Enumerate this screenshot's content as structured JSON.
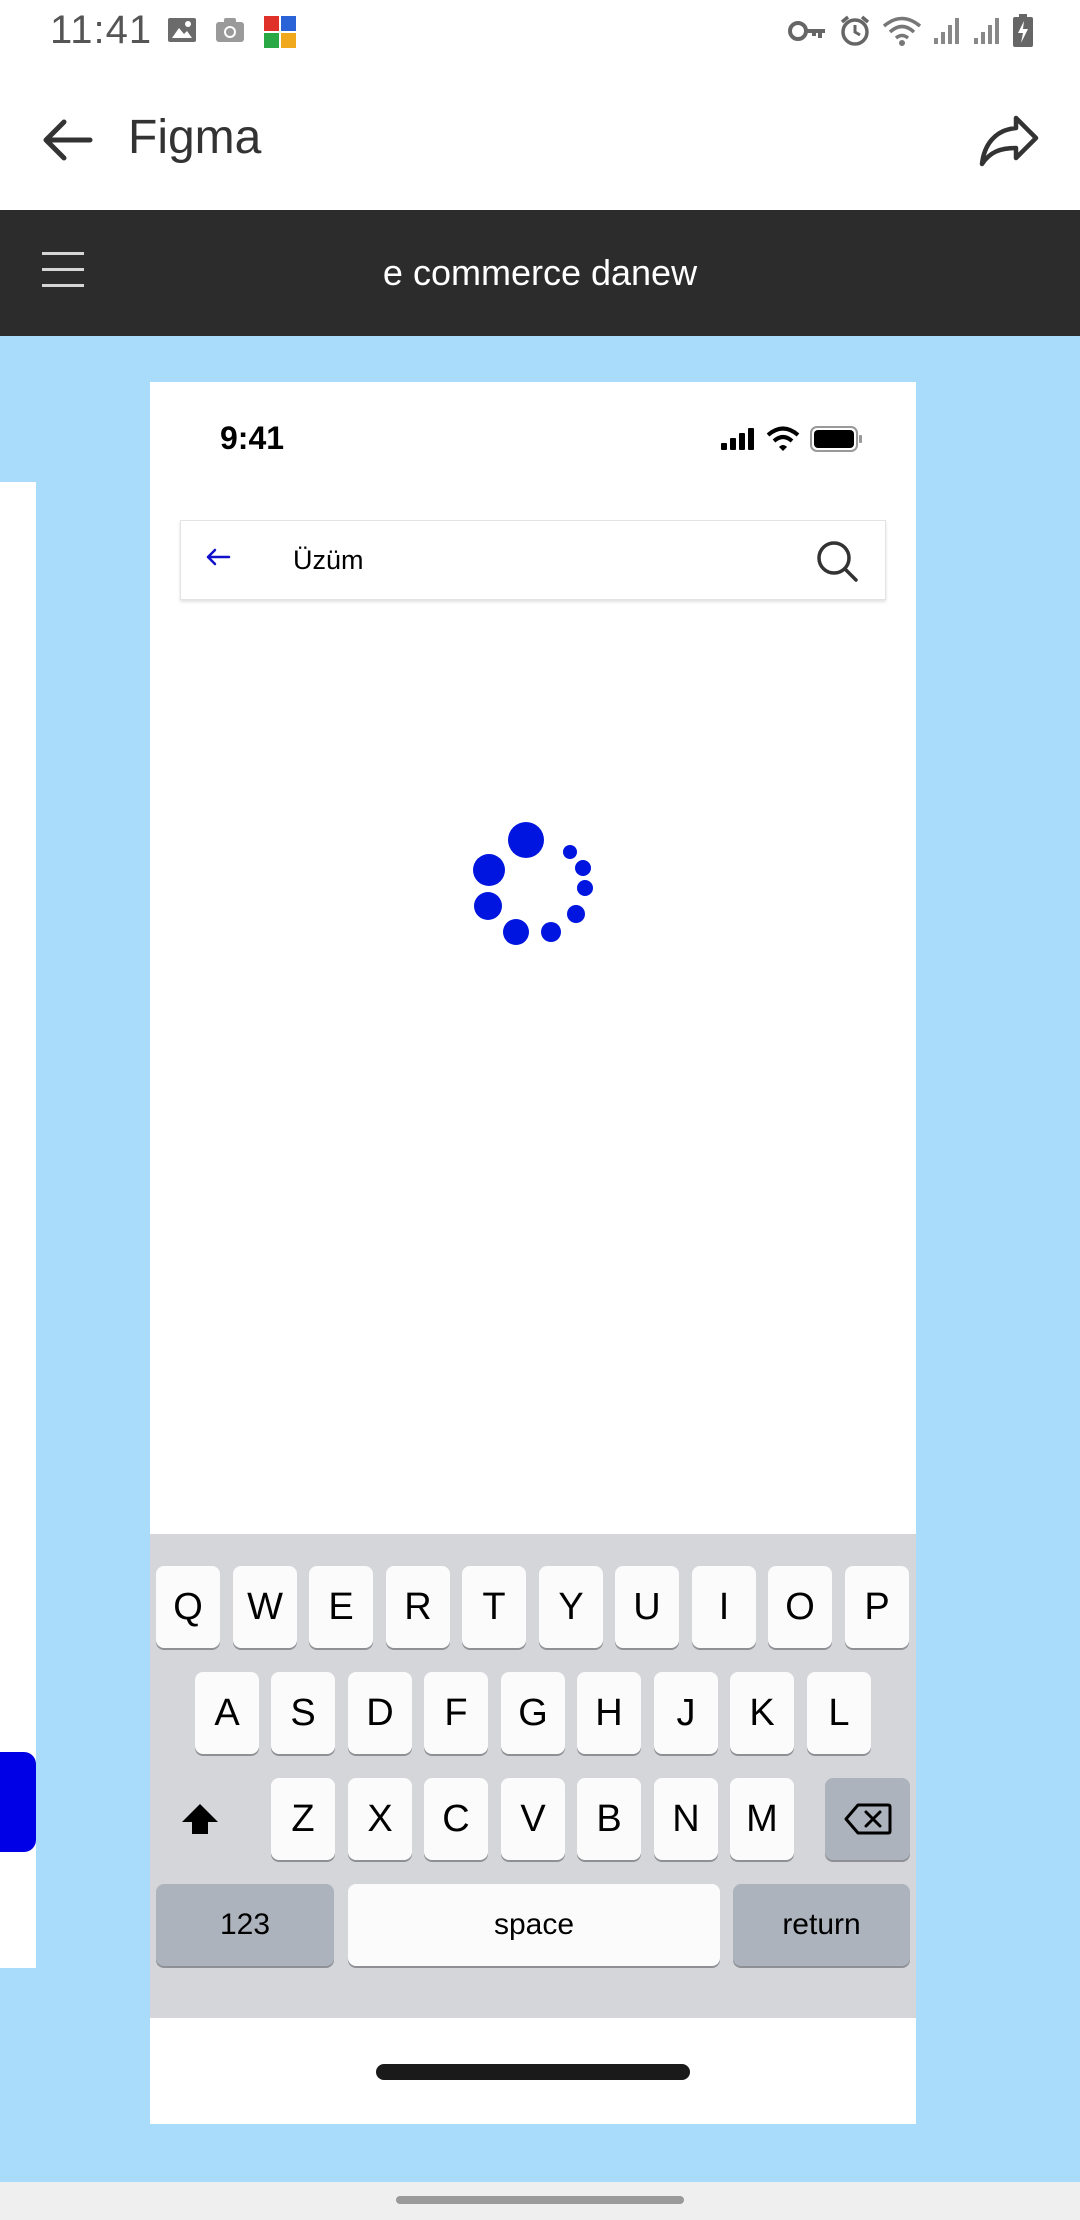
{
  "system_status": {
    "time": "11:41",
    "left_icons": [
      "gallery-icon",
      "camera-icon",
      "puzzle-app-icon"
    ],
    "right_icons": [
      "vpn-key-icon",
      "alarm-icon",
      "wifi-icon",
      "signal-icon",
      "signal-icon",
      "battery-charging-icon"
    ]
  },
  "appbar": {
    "title": "Figma",
    "back_icon": "arrow-left-icon",
    "share_icon": "share-icon"
  },
  "figma_toolbar": {
    "menu_icon": "hamburger-menu-icon",
    "file_title": "e commerce danew"
  },
  "colors": {
    "canvas_bg": "#a9dcfb",
    "toolbar_bg": "#2c2c2c",
    "accent_blue": "#0000e6",
    "keyboard_bg": "#d5d6da"
  },
  "prototype": {
    "status_time": "9:41",
    "search": {
      "value": "Üzüm",
      "back_icon": "arrow-left-icon",
      "search_icon": "magnifier-icon"
    },
    "loading_indicator": "spinner-dots",
    "keyboard": {
      "row1": [
        "Q",
        "W",
        "E",
        "R",
        "T",
        "Y",
        "U",
        "I",
        "O",
        "P"
      ],
      "row2": [
        "A",
        "S",
        "D",
        "F",
        "G",
        "H",
        "J",
        "K",
        "L"
      ],
      "row3": [
        "Z",
        "X",
        "C",
        "V",
        "B",
        "N",
        "M"
      ],
      "shift_icon": "shift-icon",
      "delete_icon": "backspace-icon",
      "numbers_label": "123",
      "space_label": "space",
      "return_label": "return"
    }
  }
}
